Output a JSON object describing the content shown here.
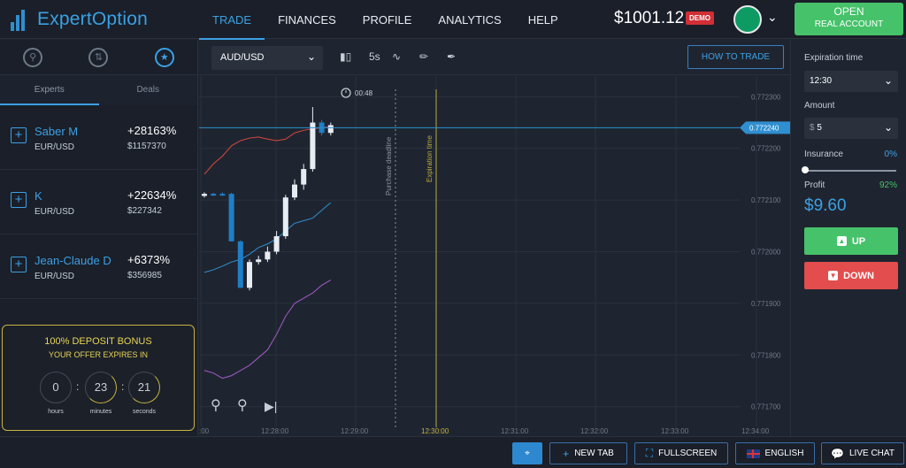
{
  "app": {
    "logo_text": "ExpertOption"
  },
  "nav": {
    "items": [
      {
        "label": "TRADE",
        "active": true
      },
      {
        "label": "FINANCES"
      },
      {
        "label": "PROFILE"
      },
      {
        "label": "ANALYTICS"
      },
      {
        "label": "HELP"
      }
    ]
  },
  "account": {
    "balance": "$1001.12",
    "mode_badge": "DEMO",
    "open_line1": "OPEN",
    "open_line2": "REAL ACCOUNT"
  },
  "left": {
    "tabs": {
      "experts": "Experts",
      "deals": "Deals"
    },
    "experts": [
      {
        "name": "Saber M",
        "pair": "EUR/USD",
        "percent": "+28163%",
        "amount": "$1157370"
      },
      {
        "name": "K",
        "pair": "EUR/USD",
        "percent": "+22634%",
        "amount": "$227342"
      },
      {
        "name": "Jean-Claude D",
        "pair": "EUR/USD",
        "percent": "+6373%",
        "amount": "$356985"
      }
    ],
    "bonus": {
      "title": "100% DEPOSIT BONUS",
      "subtitle": "YOUR OFFER EXPIRES IN",
      "hours": "0",
      "minutes": "23",
      "seconds": "21",
      "hours_label": "hours",
      "minutes_label": "minutes",
      "seconds_label": "seconds"
    }
  },
  "toolbar": {
    "pair": "AUD/USD",
    "timeframe": "5s",
    "how_to_trade": "HOW TO TRADE"
  },
  "chart": {
    "countdown": "00:48",
    "purchase_deadline": "Purchase deadline",
    "expiration_time": "Expiration time",
    "current_price": "0.772240",
    "price_ticks": [
      "0.772300",
      "0.772200",
      "0.772100",
      "0.772000",
      "0.771900",
      "0.771800",
      "0.771700"
    ],
    "time_ticks": [
      ":00",
      "12:28:00",
      "12:29:00",
      "12:30:00",
      "12:31:00",
      "12:32:00",
      "12:33:00",
      "12:34:00"
    ]
  },
  "chart_data": {
    "type": "candlestick",
    "ylim": [
      0.77166,
      0.77234
    ],
    "candles": [
      {
        "o": 0.772112,
        "h": 0.772115,
        "l": 0.772105,
        "c": 0.772108,
        "color": "white"
      },
      {
        "o": 0.772112,
        "h": 0.772114,
        "l": 0.772108,
        "c": 0.77211,
        "color": "blue"
      },
      {
        "o": 0.772112,
        "h": 0.772115,
        "l": 0.772108,
        "c": 0.772112,
        "color": "blue"
      },
      {
        "o": 0.772112,
        "h": 0.772114,
        "l": 0.77202,
        "c": 0.77202,
        "color": "blue"
      },
      {
        "o": 0.77202,
        "h": 0.772022,
        "l": 0.77193,
        "c": 0.77193,
        "color": "blue"
      },
      {
        "o": 0.77193,
        "h": 0.771985,
        "l": 0.771925,
        "c": 0.77198,
        "color": "white"
      },
      {
        "o": 0.77198,
        "h": 0.771992,
        "l": 0.771975,
        "c": 0.771985,
        "color": "white"
      },
      {
        "o": 0.771985,
        "h": 0.77201,
        "l": 0.77198,
        "c": 0.772,
        "color": "white"
      },
      {
        "o": 0.772,
        "h": 0.77204,
        "l": 0.771995,
        "c": 0.77203,
        "color": "white"
      },
      {
        "o": 0.77203,
        "h": 0.77211,
        "l": 0.772025,
        "c": 0.772105,
        "color": "white"
      },
      {
        "o": 0.772105,
        "h": 0.77214,
        "l": 0.7721,
        "c": 0.77213,
        "color": "white"
      },
      {
        "o": 0.77213,
        "h": 0.77217,
        "l": 0.77212,
        "c": 0.77216,
        "color": "white"
      },
      {
        "o": 0.77216,
        "h": 0.77228,
        "l": 0.772155,
        "c": 0.77225,
        "color": "white"
      },
      {
        "o": 0.77225,
        "h": 0.772255,
        "l": 0.772225,
        "c": 0.77223,
        "color": "blue"
      },
      {
        "o": 0.77223,
        "h": 0.77225,
        "l": 0.772225,
        "c": 0.772245,
        "color": "white"
      }
    ],
    "upper_band": [
      0.77215,
      0.77217,
      0.772185,
      0.772205,
      0.772215,
      0.77222,
      0.772222,
      0.772218,
      0.772215,
      0.772218,
      0.77223,
      0.772235,
      0.772238,
      0.77224,
      0.772242
    ],
    "middle_band": [
      0.77196,
      0.771965,
      0.771972,
      0.77198,
      0.771985,
      0.771995,
      0.772008,
      0.772015,
      0.772025,
      0.77204,
      0.772055,
      0.77206,
      0.772065,
      0.77208,
      0.772095
    ],
    "lower_band": [
      0.77177,
      0.771765,
      0.771755,
      0.77176,
      0.77177,
      0.77178,
      0.771795,
      0.77181,
      0.77184,
      0.771875,
      0.7719,
      0.77191,
      0.77192,
      0.771935,
      0.771945
    ]
  },
  "trade": {
    "expiration_label": "Expiration time",
    "expiration_value": "12:30",
    "amount_label": "Amount",
    "amount_currency": "$",
    "amount_value": "5",
    "insurance_label": "Insurance",
    "insurance_value": "0%",
    "insurance_fraction": 0.0,
    "profit_label": "Profit",
    "profit_percent": "92%",
    "profit_amount": "$9.60",
    "up_label": "UP",
    "down_label": "DOWN"
  },
  "bottom": {
    "new_tab": "NEW TAB",
    "fullscreen": "FULLSCREEN",
    "language": "ENGLISH",
    "live_chat": "LIVE CHAT"
  },
  "colors": {
    "accent": "#3da0e4",
    "up": "#46c26a",
    "down": "#e34d4d",
    "demo": "#d12f35",
    "bonus": "#c9b441"
  }
}
